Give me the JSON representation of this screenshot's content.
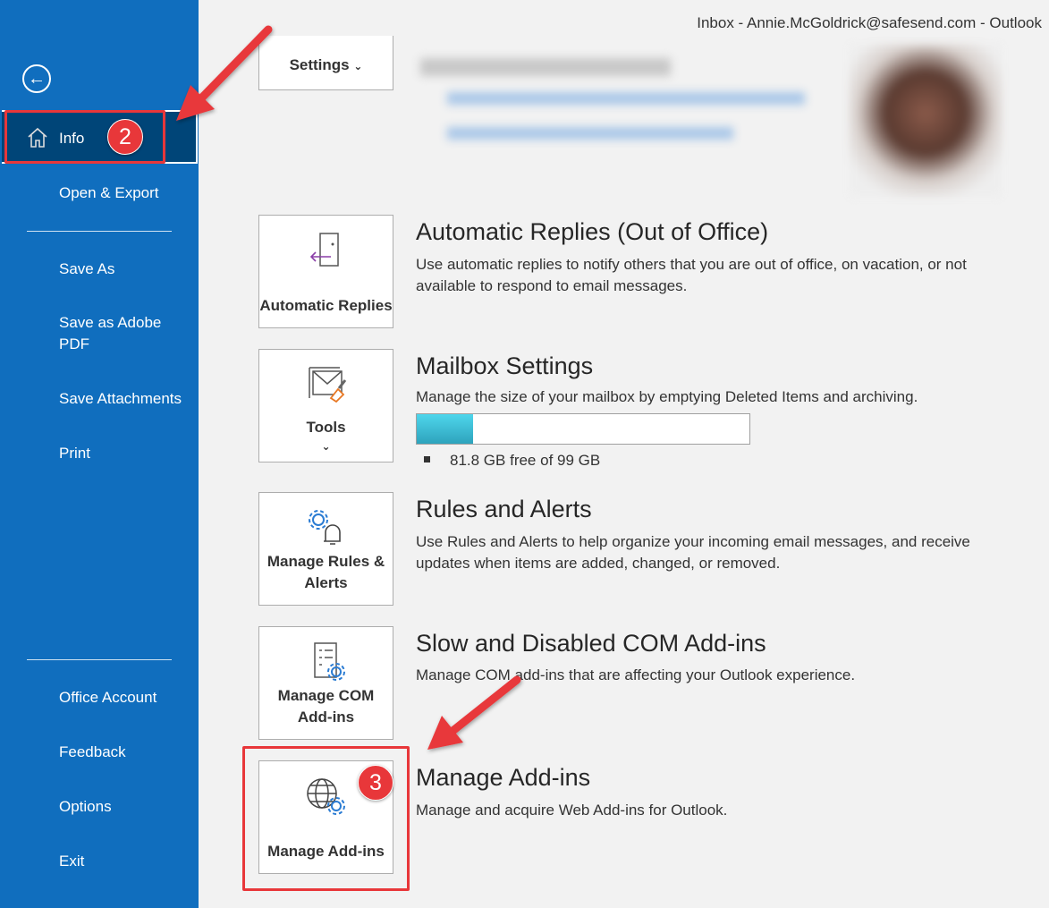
{
  "window_title": "Inbox - Annie.McGoldrick@safesend.com  -  Outlook",
  "sidebar": {
    "items": [
      {
        "label": "Info"
      },
      {
        "label": "Open & Export"
      },
      {
        "label": "Save As"
      },
      {
        "label": "Save as Adobe PDF"
      },
      {
        "label": "Save Attachments"
      },
      {
        "label": "Print"
      },
      {
        "label": "Office Account"
      },
      {
        "label": "Feedback"
      },
      {
        "label": "Options"
      },
      {
        "label": "Exit"
      }
    ]
  },
  "account_settings": {
    "label": "Settings",
    "chevron": "⌄"
  },
  "sections": [
    {
      "tile": "Automatic Replies",
      "title": "Automatic Replies (Out of Office)",
      "desc": "Use automatic replies to notify others that you are out of office, on vacation, or not available to respond to email messages."
    },
    {
      "tile": "Tools",
      "title": "Mailbox Settings",
      "desc": "Manage the size of your mailbox by emptying Deleted Items and archiving.",
      "storage_text": "81.8 GB free of 99 GB",
      "used_fraction": 0.17
    },
    {
      "tile": "Manage Rules & Alerts",
      "title": "Rules and Alerts",
      "desc": "Use Rules and Alerts to help organize your incoming email messages, and receive updates when items are added, changed, or removed."
    },
    {
      "tile": "Manage COM Add-ins",
      "title": "Slow and Disabled COM Add-ins",
      "desc": "Manage COM add-ins that are affecting your Outlook experience."
    },
    {
      "tile": "Manage Add-ins",
      "title": "Manage Add-ins",
      "desc": "Manage and acquire Web Add-ins for Outlook."
    }
  ],
  "annotations": {
    "step2": "2",
    "step3": "3"
  },
  "colors": {
    "sidebar": "#106ebe",
    "selected": "#004578",
    "annotation": "#e8373a",
    "progress": "#3cbfd8"
  }
}
